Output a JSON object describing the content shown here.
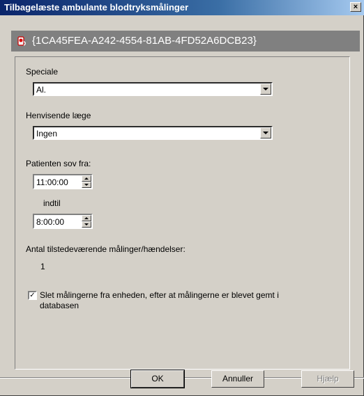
{
  "window": {
    "title": "Tilbagelæste ambulante blodtryksmålinger",
    "close_label": "×"
  },
  "device_id": "{1CA45FEA-A242-4554-81AB-4FD52A6DCB23}",
  "form": {
    "speciale_label": "Speciale",
    "speciale_value": "Al.",
    "henvisende_label": "Henvisende læge",
    "henvisende_value": "Ingen",
    "sleep_from_label": "Patienten sov fra:",
    "sleep_from_value": "11:00:00",
    "sleep_to_label": "indtil",
    "sleep_to_value": "8:00:00",
    "count_label": "Antal tilstedeværende målinger/hændelser:",
    "count_value": "1",
    "delete_checkbox_checked": true,
    "delete_label_line1": "Slet målingerne fra enheden, efter at målingerne er blevet gemt i",
    "delete_label_line2": "databasen"
  },
  "buttons": {
    "ok": "OK",
    "cancel": "Annuller",
    "help": "Hjælp"
  },
  "icons": {
    "device_icon": "blood-pressure-device-icon",
    "check_mark": "✓"
  }
}
